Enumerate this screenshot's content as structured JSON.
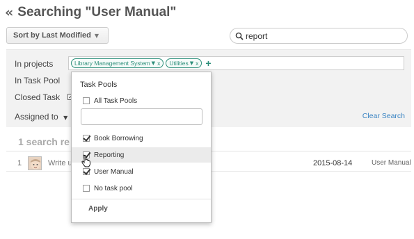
{
  "header": {
    "back_glyph": "«",
    "title": "Searching \"User Manual\""
  },
  "toolbar": {
    "sort_label": "Sort by Last Modified",
    "sort_caret": "▼",
    "search_value": "report"
  },
  "filters": {
    "projects_label": "In projects",
    "project_tags": [
      {
        "label": "Library Management System",
        "caret": "▼",
        "remove": "x"
      },
      {
        "label": "Utilities",
        "caret": "▼",
        "remove": "x"
      }
    ],
    "add_glyph": "+",
    "task_pool_label": "In Task Pool",
    "closed_task_label": "Closed Task",
    "closed_check": "✓",
    "assigned_label": "Assigned to",
    "assigned_caret": "▼",
    "clear_search": "Clear Search"
  },
  "results": {
    "count_text": "1 search re",
    "rows": [
      {
        "num": "1",
        "title": "Write u",
        "date": "2015-08-14",
        "pool": "User Manual"
      }
    ]
  },
  "task_pools_dropdown": {
    "title": "Task Pools",
    "all_label": "All Task Pools",
    "filter_value": "",
    "options": [
      {
        "label": "Book Borrowing",
        "checked": true
      },
      {
        "label": "Reporting",
        "checked": true
      },
      {
        "label": "User Manual",
        "checked": true
      },
      {
        "label": "No task pool",
        "checked": false
      }
    ],
    "apply_label": "Apply"
  },
  "colors": {
    "tag_accent": "#2d8f7a",
    "link": "#3a84c3",
    "panel_bg": "#f2f2f2"
  }
}
